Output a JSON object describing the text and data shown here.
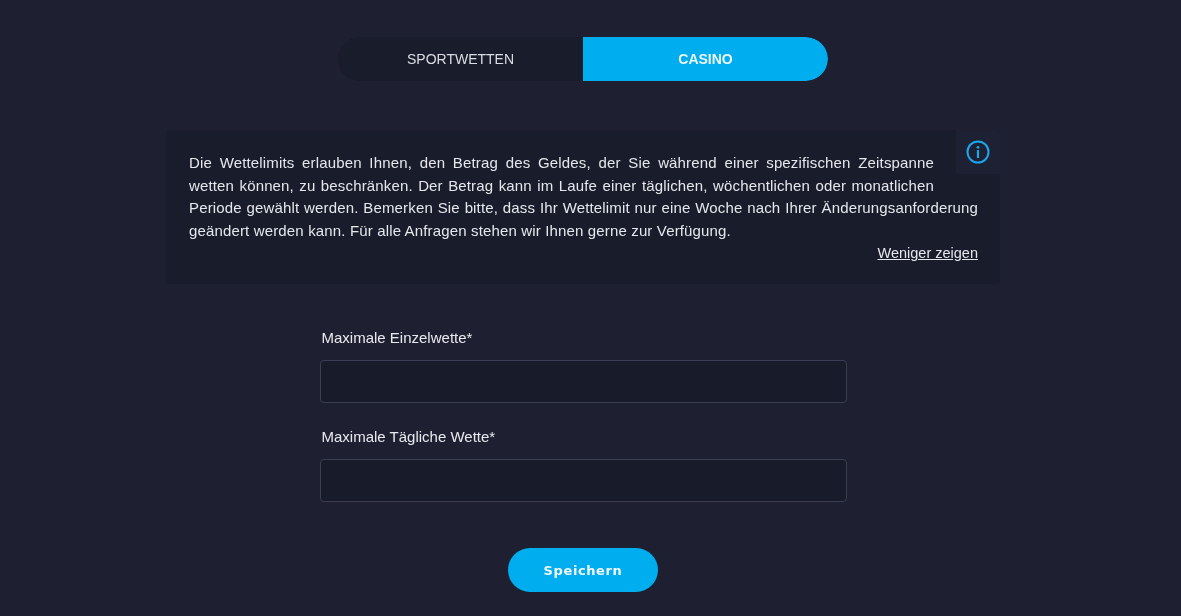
{
  "tabs": [
    {
      "label": "SPORTWETTEN",
      "selected": false
    },
    {
      "label": "CASINO",
      "selected": true
    }
  ],
  "info": {
    "text": "Die Wettelimits erlauben Ihnen, den Betrag des Geldes, der Sie während einer spezifischen Zeitspanne wetten können, zu beschränken. Der Betrag kann im Laufe einer täglichen, wöchentlichen oder monatlichen Periode gewählt werden. Bemerken Sie bitte, dass Ihr Wettelimit nur eine Woche nach Ihrer Änderungsanforderung geändert werden kann. Für alle Anfragen stehen wir Ihnen gerne zur Verfügung.",
    "toggle_link": "Weniger zeigen"
  },
  "fields": [
    {
      "label": "Maximale Einzelwette*"
    },
    {
      "label": "Maximale Tägliche Wette*"
    }
  ],
  "save_button": "Speichern"
}
